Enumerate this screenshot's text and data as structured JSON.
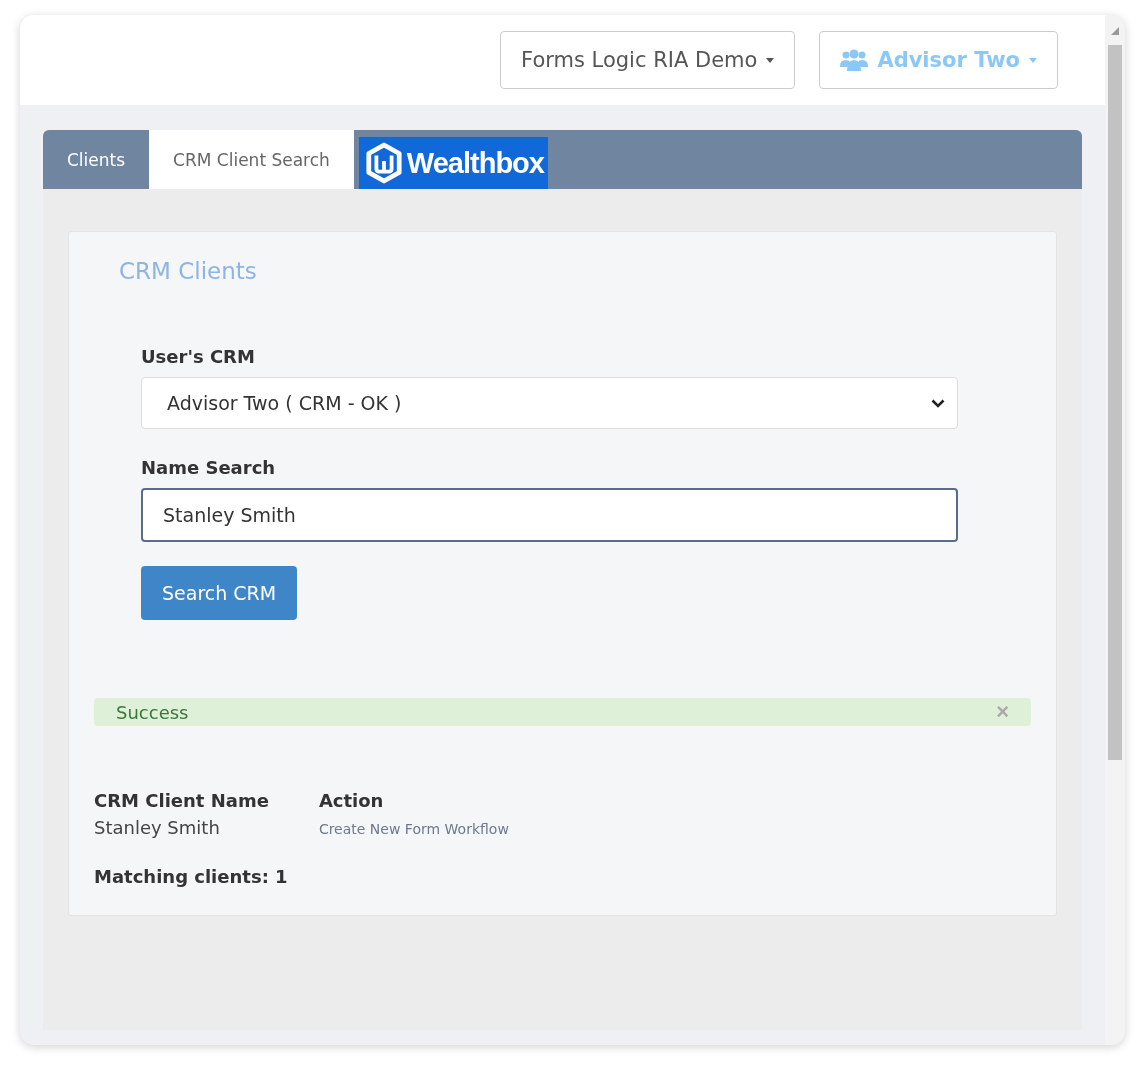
{
  "header": {
    "menus": [
      {
        "kind": "plain",
        "label": "Forms Logic RIA Demo"
      },
      {
        "kind": "user",
        "label": "Advisor Two"
      }
    ]
  },
  "tabs": [
    {
      "kind": "text",
      "label": "Clients",
      "selected": false
    },
    {
      "kind": "text",
      "label": "CRM Client Search",
      "selected": true
    },
    {
      "kind": "logo",
      "label": "Wealthbox",
      "selected": false
    }
  ],
  "panel": {
    "title": "CRM Clients",
    "crm_field": {
      "label": "User's CRM",
      "value": "Advisor Two ( CRM - OK )"
    },
    "name_field": {
      "label": "Name Search",
      "value": "Stanley Smith"
    },
    "search_button": "Search CRM",
    "alert": {
      "text": "Success",
      "close": "×"
    },
    "results": {
      "columns": [
        "CRM Client Name",
        "Action"
      ],
      "rows": [
        {
          "name": "Stanley Smith",
          "action": "Create New Form Workflow"
        }
      ],
      "summary": "Matching clients: 1"
    }
  }
}
